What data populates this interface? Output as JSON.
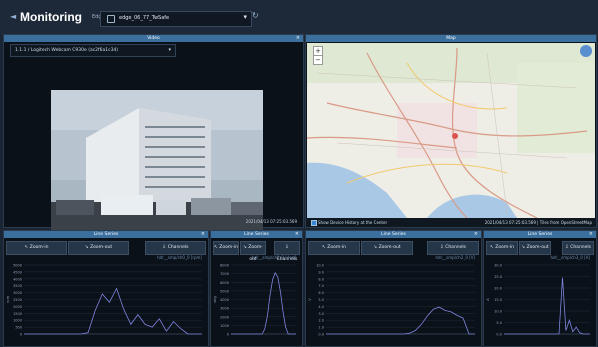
{
  "header": {
    "back_icon": "chevron-left-icon",
    "title": "Monitoring",
    "edge_label": "Edge",
    "edge_value": "edge_06_77_TwSafe",
    "refresh_icon": "refresh-icon"
  },
  "video": {
    "title": "Video",
    "close": "×",
    "camera_option": "1.1.1 / Logitech Webcam C930e (ac2f6a1c34)",
    "timestamp": "2021/04/13 07:25:03.569"
  },
  "map": {
    "title": "Map",
    "close": "×",
    "zoom_in": "+",
    "zoom_out": "−",
    "show_label": "Show Device History at the Center",
    "attribution": "2021/04/13 07:25:03.569 | Tiles from OpenStreetMap"
  },
  "line_series": [
    {
      "title": "Line Series",
      "zoom_in": "Zoom-in",
      "zoom_out": "Zoom-out",
      "channels": "Channels",
      "series_name": "hdr__smp/ch0_0 [rpm]",
      "y_ticks": [
        "5000",
        "4500",
        "4000",
        "3500",
        "3000",
        "2500",
        "2000",
        "1500",
        "1000",
        "500",
        "0"
      ],
      "ylabel": "rpm",
      "chart_data": {
        "type": "line",
        "ylim": [
          0,
          5000
        ],
        "x": [
          0,
          4,
          8,
          12,
          16,
          20,
          24,
          28,
          32,
          36,
          40,
          44,
          48,
          52,
          56,
          60,
          64,
          68,
          72,
          76,
          80,
          84,
          88,
          92,
          96,
          100
        ],
        "values": [
          0,
          0,
          0,
          0,
          0,
          0,
          0,
          0,
          0,
          100,
          1700,
          2900,
          2300,
          3300,
          1800,
          700,
          1400,
          700,
          500,
          1100,
          200,
          900,
          400,
          0,
          0,
          0
        ]
      }
    },
    {
      "title": "Line Series",
      "zoom_in": "Zoom-in",
      "zoom_out": "Zoom-out",
      "channels": "Channels",
      "series_name": "hdr__smp/ch1_0 [deg]",
      "y_ticks": [
        "8000",
        "7000",
        "6000",
        "5000",
        "4000",
        "3000",
        "2000",
        "1000",
        "0"
      ],
      "ylabel": "deg",
      "chart_data": {
        "type": "line",
        "ylim": [
          0,
          8000
        ],
        "x": [
          0,
          4,
          8,
          12,
          16,
          20,
          24,
          28,
          32,
          36,
          40,
          44,
          48,
          52,
          56,
          60,
          64,
          68,
          72,
          76,
          80,
          84,
          88,
          92,
          96,
          100
        ],
        "values": [
          0,
          0,
          0,
          0,
          0,
          0,
          0,
          0,
          0,
          0,
          0,
          0,
          0,
          600,
          2100,
          4500,
          6300,
          7100,
          6600,
          4900,
          2600,
          800,
          0,
          0,
          0,
          0
        ]
      }
    },
    {
      "title": "Line Series",
      "zoom_in": "Zoom-in",
      "zoom_out": "Zoom-out",
      "channels": "Channels",
      "series_name": "hdr__smp/ch2_0 [V]",
      "y_ticks": [
        "10.0",
        "9.0",
        "8.0",
        "7.0",
        "6.0",
        "5.0",
        "4.0",
        "3.0",
        "2.0",
        "1.0",
        "0.0"
      ],
      "ylabel": "V",
      "chart_data": {
        "type": "line",
        "ylim": [
          0,
          10
        ],
        "x": [
          0,
          4,
          8,
          12,
          16,
          20,
          24,
          28,
          32,
          36,
          40,
          44,
          48,
          52,
          56,
          60,
          64,
          68,
          72,
          76,
          80,
          84,
          88,
          92,
          96,
          100
        ],
        "values": [
          0,
          0,
          0,
          0,
          0,
          0,
          0,
          0,
          0,
          0,
          0,
          0,
          0,
          0,
          0.1,
          0.5,
          1.4,
          2.6,
          3.6,
          3.9,
          3.4,
          3.2,
          2.7,
          2.3,
          0,
          0
        ]
      }
    },
    {
      "title": "Line Series",
      "zoom_in": "Zoom-in",
      "zoom_out": "Zoom-out",
      "channels": "Channels",
      "series_name": "hdr__smp/ch3_0 [A]",
      "y_ticks": [
        "30.0",
        "25.0",
        "20.0",
        "15.0",
        "10.0",
        "5.0",
        "0.0"
      ],
      "ylabel": "A",
      "chart_data": {
        "type": "line",
        "ylim": [
          0,
          30
        ],
        "x": [
          0,
          4,
          8,
          12,
          16,
          20,
          24,
          28,
          32,
          36,
          40,
          44,
          48,
          52,
          56,
          60,
          64,
          68,
          72,
          76,
          80,
          84,
          88,
          92,
          96,
          100
        ],
        "values": [
          0,
          0,
          0,
          0,
          0,
          0,
          0,
          0,
          0,
          0,
          0,
          0,
          0,
          0,
          0,
          0,
          0,
          24.5,
          1.5,
          6.0,
          1.0,
          3.0,
          0.5,
          0,
          0,
          0
        ]
      }
    }
  ],
  "colors": {
    "accent": "#3a6f9e",
    "line": "#7f86e0",
    "bg": "#1b2634"
  }
}
